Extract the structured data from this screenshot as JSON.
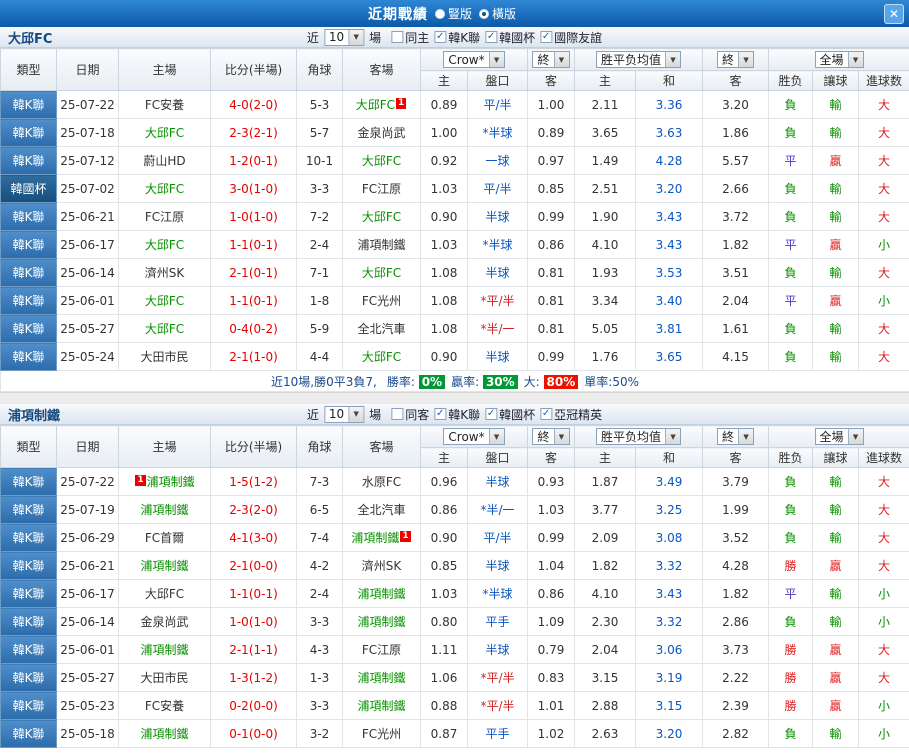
{
  "icons": {
    "dropdown_arrow": "▼",
    "check": "✓"
  },
  "titlebar": {
    "title": "近期戰績",
    "radios": [
      {
        "label": "豎版",
        "selected": false
      },
      {
        "label": "橫版",
        "selected": true
      }
    ],
    "close_glyph": "✕"
  },
  "columns": [
    "類型",
    "日期",
    "主場",
    "比分(半場)",
    "角球",
    "客場",
    "主",
    "盤口",
    "客",
    "主",
    "和",
    "客",
    "胜负",
    "讓球",
    "進球数"
  ],
  "sections": [
    {
      "team": "大邱FC",
      "controls": {
        "near_label": "近",
        "match_count": "10",
        "games_label": "場",
        "odds_select": "Crow*",
        "final_select": "終",
        "avg_select": "胜平负均值",
        "final2_select": "終",
        "fullmatch_select": "全場"
      },
      "filters": [
        {
          "label": "同主",
          "checked": false
        },
        {
          "label": "韓K聯",
          "checked": true
        },
        {
          "label": "韓國杯",
          "checked": true
        },
        {
          "label": "國際友誼",
          "checked": true
        }
      ],
      "rows": [
        {
          "league": "韓K聯",
          "date": "25-07-22",
          "home": "FC安養",
          "score": "4-0(2-0)",
          "corners": "5-3",
          "away": "大邱FC",
          "away_focus": true,
          "away_badge": "1",
          "o_home": "0.89",
          "hcp": "平/半",
          "o_away": "1.00",
          "a_home": "2.11",
          "a_draw": "3.36",
          "a_away": "3.20",
          "res": "負",
          "hres": "輸",
          "gres": "大"
        },
        {
          "league": "韓K聯",
          "date": "25-07-18",
          "home": "大邱FC",
          "home_focus": true,
          "score": "2-3(2-1)",
          "corners": "5-7",
          "away": "金泉尚武",
          "o_home": "1.00",
          "hcp": "*半球",
          "o_away": "0.89",
          "a_home": "3.65",
          "a_draw": "3.63",
          "a_away": "1.86",
          "res": "負",
          "hres": "輸",
          "gres": "大"
        },
        {
          "league": "韓K聯",
          "date": "25-07-12",
          "home": "蔚山HD",
          "score": "1-2(0-1)",
          "corners": "10-1",
          "away": "大邱FC",
          "away_focus": true,
          "o_home": "0.92",
          "hcp": "一球",
          "o_away": "0.97",
          "a_home": "1.49",
          "a_draw": "4.28",
          "a_away": "5.57",
          "res": "平",
          "hres": "贏",
          "gres": "大"
        },
        {
          "league": "韓國杯",
          "cup": true,
          "date": "25-07-02",
          "home": "大邱FC",
          "home_focus": true,
          "score": "3-0(1-0)",
          "corners": "3-3",
          "away": "FC江原",
          "o_home": "1.03",
          "hcp": "平/半",
          "o_away": "0.85",
          "a_home": "2.51",
          "a_draw": "3.20",
          "a_away": "2.66",
          "res": "負",
          "hres": "輸",
          "gres": "大"
        },
        {
          "league": "韓K聯",
          "date": "25-06-21",
          "home": "FC江原",
          "score": "1-0(1-0)",
          "corners": "7-2",
          "away": "大邱FC",
          "away_focus": true,
          "o_home": "0.90",
          "hcp": "半球",
          "o_away": "0.99",
          "a_home": "1.90",
          "a_draw": "3.43",
          "a_away": "3.72",
          "res": "負",
          "hres": "輸",
          "gres": "大"
        },
        {
          "league": "韓K聯",
          "date": "25-06-17",
          "home": "大邱FC",
          "home_focus": true,
          "score": "1-1(0-1)",
          "corners": "2-4",
          "away": "浦項制鐵",
          "o_home": "1.03",
          "hcp": "*半球",
          "o_away": "0.86",
          "a_home": "4.10",
          "a_draw": "3.43",
          "a_away": "1.82",
          "res": "平",
          "hres": "贏",
          "gres": "小"
        },
        {
          "league": "韓K聯",
          "date": "25-06-14",
          "home": "濟州SK",
          "score": "2-1(0-1)",
          "corners": "7-1",
          "away": "大邱FC",
          "away_focus": true,
          "o_home": "1.08",
          "hcp": "半球",
          "o_away": "0.81",
          "a_home": "1.93",
          "a_draw": "3.53",
          "a_away": "3.51",
          "res": "負",
          "hres": "輸",
          "gres": "大"
        },
        {
          "league": "韓K聯",
          "date": "25-06-01",
          "home": "大邱FC",
          "home_focus": true,
          "score": "1-1(0-1)",
          "corners": "1-8",
          "away": "FC光州",
          "o_home": "1.08",
          "hcp": "*平/半",
          "hcp_red": true,
          "o_away": "0.81",
          "a_home": "3.34",
          "a_draw": "3.40",
          "a_away": "2.04",
          "res": "平",
          "hres": "贏",
          "gres": "小"
        },
        {
          "league": "韓K聯",
          "date": "25-05-27",
          "home": "大邱FC",
          "home_focus": true,
          "score": "0-4(0-2)",
          "corners": "5-9",
          "away": "全北汽車",
          "o_home": "1.08",
          "hcp": "*半/一",
          "hcp_red": true,
          "o_away": "0.81",
          "a_home": "5.05",
          "a_draw": "3.81",
          "a_away": "1.61",
          "res": "負",
          "hres": "輸",
          "gres": "大"
        },
        {
          "league": "韓K聯",
          "date": "25-05-24",
          "home": "大田市民",
          "score": "2-1(1-0)",
          "corners": "4-4",
          "away": "大邱FC",
          "away_focus": true,
          "o_home": "0.90",
          "hcp": "半球",
          "o_away": "0.99",
          "a_home": "1.76",
          "a_draw": "3.65",
          "a_away": "4.15",
          "res": "負",
          "hres": "輸",
          "gres": "大"
        }
      ],
      "stats": {
        "summary": "近10場,勝0平3負7,",
        "items": [
          {
            "label": "勝率: ",
            "value": "0%",
            "style": "green"
          },
          {
            "label": "贏率: ",
            "value": "30%",
            "style": "green"
          },
          {
            "label": "大: ",
            "value": "80%",
            "style": "red"
          },
          {
            "label": "單率:",
            "value": "50%",
            "style": "plain"
          }
        ]
      }
    },
    {
      "team": "浦項制鐵",
      "controls": {
        "near_label": "近",
        "match_count": "10",
        "games_label": "場",
        "odds_select": "Crow*",
        "final_select": "終",
        "avg_select": "胜平负均值",
        "final2_select": "終",
        "fullmatch_select": "全場"
      },
      "filters": [
        {
          "label": "同客",
          "checked": false
        },
        {
          "label": "韓K聯",
          "checked": true
        },
        {
          "label": "韓國杯",
          "checked": true
        },
        {
          "label": "亞冠精英",
          "checked": true
        }
      ],
      "rows": [
        {
          "league": "韓K聯",
          "date": "25-07-22",
          "home": "浦項制鐵",
          "home_focus": true,
          "home_badge": "1",
          "home_badge_before": true,
          "score": "1-5(1-2)",
          "corners": "7-3",
          "away": "水原FC",
          "o_home": "0.96",
          "hcp": "半球",
          "o_away": "0.93",
          "a_home": "1.87",
          "a_draw": "3.49",
          "a_away": "3.79",
          "res": "負",
          "hres": "輸",
          "gres": "大"
        },
        {
          "league": "韓K聯",
          "date": "25-07-19",
          "home": "浦項制鐵",
          "home_focus": true,
          "score": "2-3(2-0)",
          "corners": "6-5",
          "away": "全北汽車",
          "o_home": "0.86",
          "hcp": "*半/一",
          "o_away": "1.03",
          "a_home": "3.77",
          "a_draw": "3.25",
          "a_away": "1.99",
          "res": "負",
          "hres": "輸",
          "gres": "大"
        },
        {
          "league": "韓K聯",
          "date": "25-06-29",
          "home": "FC首爾",
          "score": "4-1(3-0)",
          "corners": "7-4",
          "away": "浦項制鐵",
          "away_focus": true,
          "away_badge": "1",
          "o_home": "0.90",
          "hcp": "平/半",
          "o_away": "0.99",
          "a_home": "2.09",
          "a_draw": "3.08",
          "a_away": "3.52",
          "res": "負",
          "hres": "輸",
          "gres": "大"
        },
        {
          "league": "韓K聯",
          "date": "25-06-21",
          "home": "浦項制鐵",
          "home_focus": true,
          "score": "2-1(0-0)",
          "corners": "4-2",
          "away": "濟州SK",
          "o_home": "0.85",
          "hcp": "半球",
          "o_away": "1.04",
          "a_home": "1.82",
          "a_draw": "3.32",
          "a_away": "4.28",
          "res": "勝",
          "hres": "贏",
          "gres": "大"
        },
        {
          "league": "韓K聯",
          "date": "25-06-17",
          "home": "大邱FC",
          "score": "1-1(0-1)",
          "corners": "2-4",
          "away": "浦項制鐵",
          "away_focus": true,
          "o_home": "1.03",
          "hcp": "*半球",
          "o_away": "0.86",
          "a_home": "4.10",
          "a_draw": "3.43",
          "a_away": "1.82",
          "res": "平",
          "hres": "輸",
          "gres": "小"
        },
        {
          "league": "韓K聯",
          "date": "25-06-14",
          "home": "金泉尚武",
          "score": "1-0(1-0)",
          "corners": "3-3",
          "away": "浦項制鐵",
          "away_focus": true,
          "o_home": "0.80",
          "hcp": "平手",
          "o_away": "1.09",
          "a_home": "2.30",
          "a_draw": "3.32",
          "a_away": "2.86",
          "res": "負",
          "hres": "輸",
          "gres": "小"
        },
        {
          "league": "韓K聯",
          "date": "25-06-01",
          "home": "浦項制鐵",
          "home_focus": true,
          "score": "2-1(1-1)",
          "corners": "4-3",
          "away": "FC江原",
          "o_home": "1.11",
          "hcp": "半球",
          "o_away": "0.79",
          "a_home": "2.04",
          "a_draw": "3.06",
          "a_away": "3.73",
          "res": "勝",
          "hres": "贏",
          "gres": "大"
        },
        {
          "league": "韓K聯",
          "date": "25-05-27",
          "home": "大田市民",
          "score": "1-3(1-2)",
          "corners": "1-3",
          "away": "浦項制鐵",
          "away_focus": true,
          "o_home": "1.06",
          "hcp": "*平/半",
          "hcp_red": true,
          "o_away": "0.83",
          "a_home": "3.15",
          "a_draw": "3.19",
          "a_away": "2.22",
          "res": "勝",
          "hres": "贏",
          "gres": "大"
        },
        {
          "league": "韓K聯",
          "date": "25-05-23",
          "home": "FC安養",
          "score": "0-2(0-0)",
          "corners": "3-3",
          "away": "浦項制鐵",
          "away_focus": true,
          "o_home": "0.88",
          "hcp": "*平/半",
          "hcp_red": true,
          "o_away": "1.01",
          "a_home": "2.88",
          "a_draw": "3.15",
          "a_away": "2.39",
          "res": "勝",
          "hres": "贏",
          "gres": "小"
        },
        {
          "league": "韓K聯",
          "date": "25-05-18",
          "home": "浦項制鐵",
          "home_focus": true,
          "score": "0-1(0-0)",
          "corners": "3-2",
          "away": "FC光州",
          "o_home": "0.87",
          "hcp": "平手",
          "o_away": "1.02",
          "a_home": "2.63",
          "a_draw": "3.20",
          "a_away": "2.82",
          "res": "負",
          "hres": "輸",
          "gres": "小"
        }
      ]
    }
  ]
}
